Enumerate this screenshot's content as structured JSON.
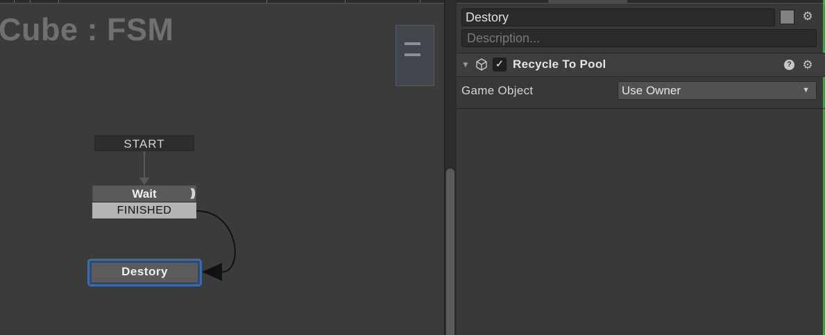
{
  "graph": {
    "title": "Cube : FSM",
    "states": {
      "start": {
        "label": "START"
      },
      "wait": {
        "label": "Wait",
        "icon": "wait-loop-icon",
        "transition": "FINISHED"
      },
      "destory": {
        "label": "Destory"
      }
    }
  },
  "inspector": {
    "state_name": "Destory",
    "description_placeholder": "Description...",
    "action": {
      "title": "Recycle To Pool",
      "enabled": true,
      "check_glyph": "✓",
      "fold_glyph": "▼",
      "help_glyph": "?",
      "fields": [
        {
          "label": "Game Object",
          "value": "Use Owner"
        }
      ]
    },
    "gear_glyph": "⚙",
    "caret_glyph": "▼"
  },
  "colors": {
    "selected_state_border": "#3d6ba8",
    "accent_green": "#43a047",
    "canvas_bg": "#3b3b3b"
  }
}
